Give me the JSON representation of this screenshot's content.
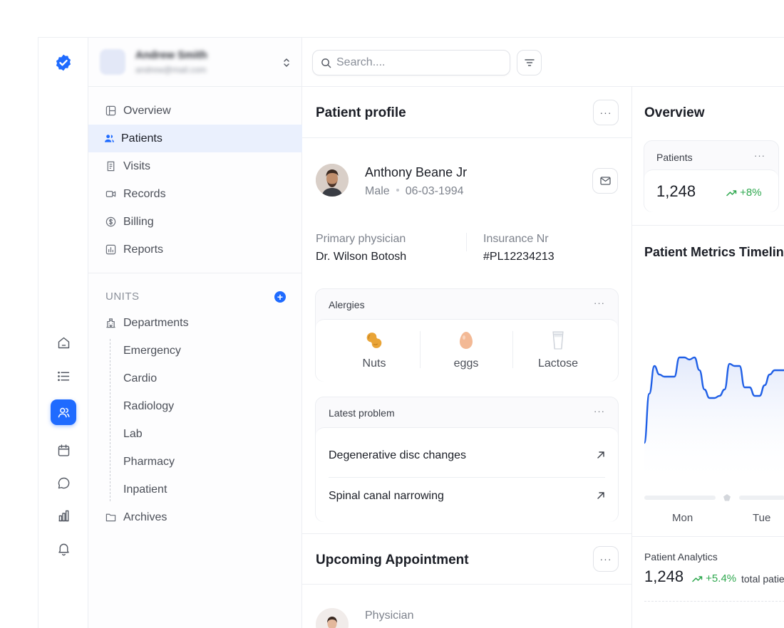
{
  "search": {
    "placeholder": "Search...."
  },
  "sidebar": {
    "nav": [
      {
        "label": "Overview"
      },
      {
        "label": "Patients"
      },
      {
        "label": "Visits"
      },
      {
        "label": "Records"
      },
      {
        "label": "Billing"
      },
      {
        "label": "Reports"
      }
    ],
    "units_heading": "UNITS",
    "units_add": "+",
    "departments_label": "Departments",
    "departments": [
      "Emergency",
      "Cardio",
      "Radiology",
      "Lab",
      "Pharmacy",
      "Inpatient"
    ],
    "archives_label": "Archives"
  },
  "profile": {
    "title": "Patient profile",
    "more": "···",
    "name": "Anthony Beane Jr",
    "gender": "Male",
    "dob": "06-03-1994",
    "physician_label": "Primary physician",
    "physician": "Dr. Wilson Botosh",
    "insurance_label": "Insurance Nr",
    "insurance": "#PL12234213",
    "allergies": {
      "title": "Alergies",
      "more": "···",
      "items": [
        {
          "name": "Nuts",
          "icon": "peanut-icon"
        },
        {
          "name": "eggs",
          "icon": "egg-icon"
        },
        {
          "name": "Lactose",
          "icon": "milk-glass-icon"
        }
      ]
    },
    "problems": {
      "title": "Latest problem",
      "more": "···",
      "items": [
        "Degenerative disc changes",
        "Spinal canal narrowing"
      ]
    },
    "appointment": {
      "title": "Upcoming Appointment",
      "more": "···",
      "physician_label": "Physician"
    }
  },
  "overview": {
    "title": "Overview",
    "patients_card": {
      "title": "Patients",
      "more": "···",
      "value": "1,248",
      "delta": "+8%"
    },
    "timeline_title": "Patient Metrics Timelin",
    "days": [
      "Mon",
      "Tue"
    ],
    "analytics": {
      "title": "Patient Analytics",
      "value": "1,248",
      "delta": "+5.4%",
      "caption": "total patie"
    }
  },
  "colors": {
    "accent": "#1f6bff",
    "positive": "#2fa84f",
    "active_bg": "#eaf0fd"
  },
  "chart_data": {
    "type": "area",
    "title": "Patient Metrics Timelin",
    "categories": [
      "Mon",
      "Tue"
    ],
    "series": [
      {
        "values": [
          40,
          63,
          76,
          72,
          71,
          71,
          71,
          80,
          80,
          79,
          80,
          74,
          65,
          61,
          61,
          62,
          65,
          77,
          76,
          76,
          66,
          66,
          62,
          62,
          67,
          72,
          74,
          74,
          74
        ]
      }
    ],
    "ylim": [
      20,
      100
    ],
    "grid": false
  }
}
